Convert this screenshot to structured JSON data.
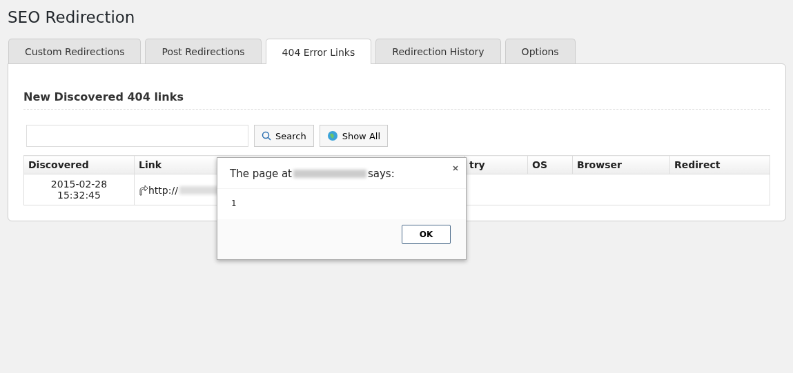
{
  "page_title": "SEO Redirection",
  "tabs": [
    {
      "label": "Custom Redirections",
      "selected": false
    },
    {
      "label": "Post Redirections",
      "selected": false
    },
    {
      "label": "404 Error Links",
      "selected": true
    },
    {
      "label": "Redirection History",
      "selected": false
    },
    {
      "label": "Options",
      "selected": false
    }
  ],
  "section_title": "New Discovered 404 links",
  "search": {
    "buttons": [
      "Search",
      "Show All"
    ]
  },
  "table": {
    "columns": [
      "Discovered",
      "Link",
      "try",
      "OS",
      "Browser",
      "Redirect"
    ],
    "rows": [
      {
        "discovered": "2015-02-28 15:32:45",
        "link": "http://"
      }
    ]
  },
  "dialog": {
    "title_start": "The page at",
    "title_end": "says:",
    "message": "1",
    "button": "OK"
  }
}
